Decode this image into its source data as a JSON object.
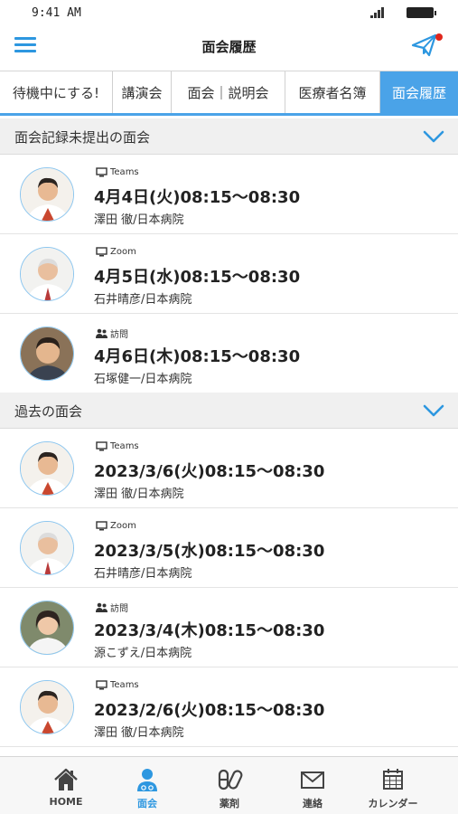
{
  "status_bar": {
    "time": "9:41 AM"
  },
  "header": {
    "title": "面会履歴"
  },
  "tabs": [
    {
      "label": "待機中にする!",
      "active": false
    },
    {
      "label": "講演会",
      "active": false
    },
    {
      "label": "面会｜説明会",
      "active": false
    },
    {
      "label": "医療者名簿",
      "active": false
    },
    {
      "label": "面会履歴",
      "active": true
    }
  ],
  "sections": {
    "pending": {
      "title": "面会記録未提出の面会",
      "items": [
        {
          "type_icon": "monitor-icon",
          "type": "Teams",
          "datetime": "4月4日(火)08:15〜08:30",
          "person": "澤田 徹/日本病院"
        },
        {
          "type_icon": "monitor-icon",
          "type": "Zoom",
          "datetime": "4月5日(水)08:15〜08:30",
          "person": "石井晴彦/日本病院"
        },
        {
          "type_icon": "people-icon",
          "type": "訪問",
          "datetime": "4月6日(木)08:15〜08:30",
          "person": "石塚健一/日本病院"
        }
      ]
    },
    "past": {
      "title": "過去の面会",
      "items": [
        {
          "type_icon": "monitor-icon",
          "type": "Teams",
          "datetime": "2023/3/6(火)08:15〜08:30",
          "person": "澤田 徹/日本病院"
        },
        {
          "type_icon": "monitor-icon",
          "type": "Zoom",
          "datetime": "2023/3/5(水)08:15〜08:30",
          "person": "石井晴彦/日本病院"
        },
        {
          "type_icon": "people-icon",
          "type": "訪問",
          "datetime": "2023/3/4(木)08:15〜08:30",
          "person": "源こずえ/日本病院"
        },
        {
          "type_icon": "monitor-icon",
          "type": "Teams",
          "datetime": "2023/2/6(火)08:15〜08:30",
          "person": "澤田 徹/日本病院"
        }
      ]
    }
  },
  "bottom_nav": [
    {
      "label": "HOME",
      "icon": "home-icon",
      "active": false
    },
    {
      "label": "面会",
      "icon": "meeting-icon",
      "active": true
    },
    {
      "label": "薬剤",
      "icon": "pills-icon",
      "active": false
    },
    {
      "label": "連絡",
      "icon": "mail-icon",
      "active": false
    },
    {
      "label": "カレンダー",
      "icon": "calendar-icon",
      "active": false
    }
  ],
  "colors": {
    "accent": "#2d97e0",
    "tab_active": "#4aa3e8",
    "notification": "#e0271d",
    "section_bg": "#f0f0f0"
  }
}
